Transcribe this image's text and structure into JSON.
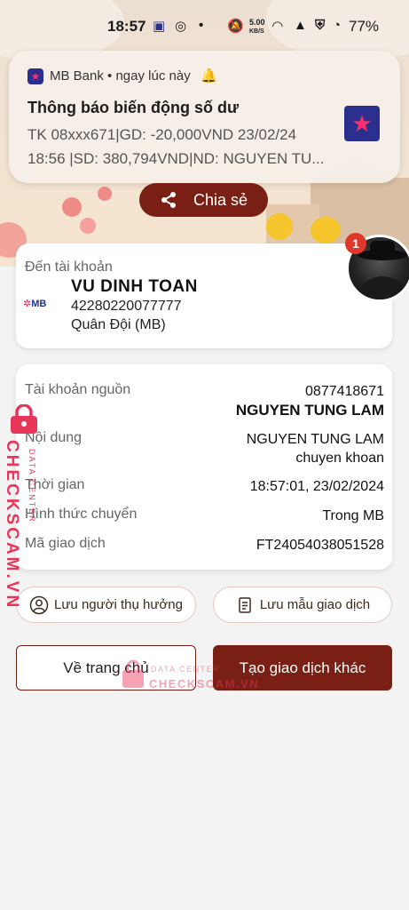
{
  "status_bar": {
    "time": "18:57",
    "net_speed": "5.00",
    "net_unit": "KB/S",
    "battery": "77%"
  },
  "notification": {
    "app_name": "MB Bank",
    "separator": "•",
    "when": "ngay lúc này",
    "title": "Thông báo biến động số dư",
    "line1": "TK 08xxx671|GD: -20,000VND 23/02/24",
    "line2": "18:56 |SD: 380,794VND|ND: NGUYEN TU..."
  },
  "share_button": {
    "label": "Chia sẻ"
  },
  "recipient": {
    "label": "Đến tài khoản",
    "bank_logo": "MB",
    "name": "VU DINH TOAN",
    "account_number": "42280220077777",
    "bank_name": "Quân Đội (MB)"
  },
  "avatar": {
    "badge_count": "1"
  },
  "details": {
    "rows": [
      {
        "key": "Tài khoản nguồn",
        "value": "0877418671",
        "value2": "NGUYEN TUNG LAM"
      },
      {
        "key": "Nội dung",
        "value": "NGUYEN TUNG LAM",
        "value2": "chuyen khoan"
      },
      {
        "key": "Thời gian",
        "value": "18:57:01, 23/02/2024"
      },
      {
        "key": "Hình thức chuyển",
        "value": "Trong MB"
      },
      {
        "key": "Mã giao dịch",
        "value": "FT24054038051528"
      }
    ]
  },
  "actions": {
    "save_beneficiary": "Lưu người thụ hưởng",
    "save_template": "Lưu mẫu giao dịch",
    "home": "Về trang chủ",
    "new_transaction": "Tạo giao dịch khác"
  },
  "watermark": {
    "brand": "CHECKSCAM.VN",
    "sub": "DATA CENTER"
  },
  "colors": {
    "accent": "#7a1f13",
    "watermark": "#e8365a",
    "bank_blue": "#22318c"
  }
}
